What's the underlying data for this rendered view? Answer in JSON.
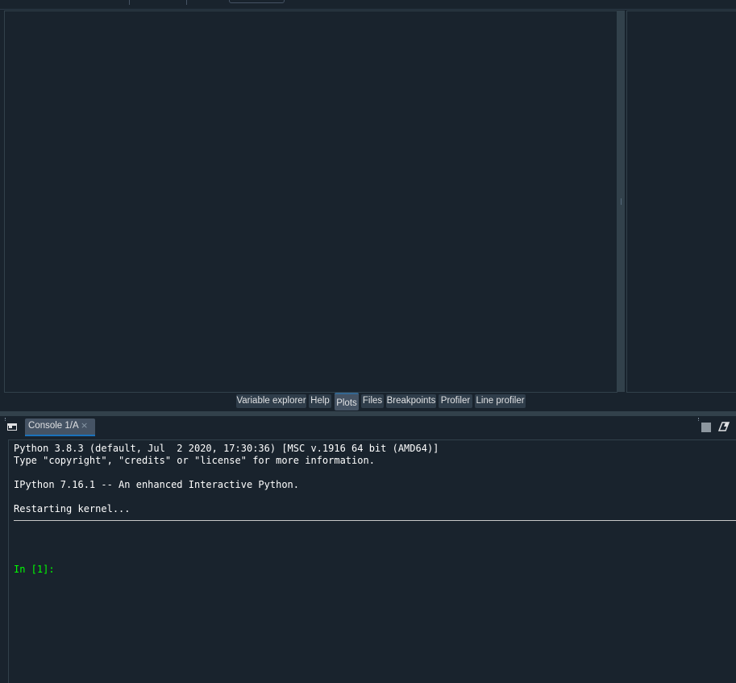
{
  "pane_tabs": [
    {
      "label": "Variable explorer",
      "active": false
    },
    {
      "label": "Help",
      "active": false
    },
    {
      "label": "Plots",
      "active": true
    },
    {
      "label": "Files",
      "active": false
    },
    {
      "label": "Breakpoints",
      "active": false
    },
    {
      "label": "Profiler",
      "active": false
    },
    {
      "label": "Line profiler",
      "active": false
    }
  ],
  "console": {
    "tab_label": "Console 1/A",
    "close_glyph": "×",
    "banner_line1": "Python 3.8.3 (default, Jul  2 2020, 17:30:36) [MSC v.1916 64 bit (AMD64)]",
    "banner_line2": "Type \"copyright\", \"credits\" or \"license\" for more information.",
    "banner_line3": "IPython 7.16.1 -- An enhanced Interactive Python.",
    "restart_message": "Restarting kernel...",
    "prompt": "In [1]:"
  },
  "icons": {
    "console_window": "window-icon",
    "stop": "stop-icon",
    "clear": "eraser-icon"
  },
  "colors": {
    "background": "#19232d",
    "tab_active": "#455364",
    "tab_inactive": "#2f3d4a",
    "prompt": "#00ff00",
    "accent": "#1a72bb"
  }
}
